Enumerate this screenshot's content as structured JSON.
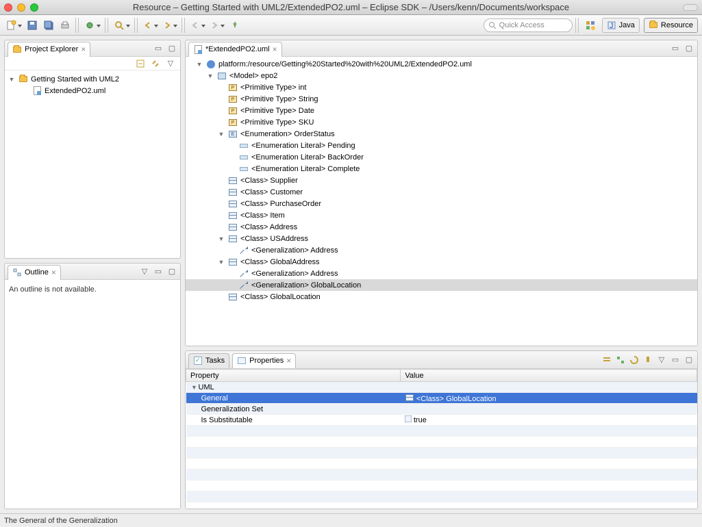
{
  "window": {
    "title": "Resource – Getting Started with UML2/ExtendedPO2.uml – Eclipse SDK – /Users/kenn/Documents/workspace"
  },
  "toolbar": {
    "quick_access_placeholder": "Quick Access",
    "perspectives": {
      "java": "Java",
      "resource": "Resource"
    }
  },
  "project_explorer": {
    "title": "Project Explorer",
    "project": "Getting Started with UML2",
    "file": "ExtendedPO2.uml"
  },
  "outline": {
    "title": "Outline",
    "empty_text": "An outline is not available."
  },
  "editor": {
    "tab_title": "*ExtendedPO2.uml",
    "root": "platform:/resource/Getting%20Started%20with%20UML2/ExtendedPO2.uml",
    "model": "<Model> epo2",
    "prim_int": "<Primitive Type> int",
    "prim_string": "<Primitive Type> String",
    "prim_date": "<Primitive Type> Date",
    "prim_sku": "<Primitive Type> SKU",
    "enum": "<Enumeration> OrderStatus",
    "enum_pending": "<Enumeration Literal> Pending",
    "enum_backorder": "<Enumeration Literal> BackOrder",
    "enum_complete": "<Enumeration Literal> Complete",
    "cls_supplier": "<Class> Supplier",
    "cls_customer": "<Class> Customer",
    "cls_po": "<Class> PurchaseOrder",
    "cls_item": "<Class> Item",
    "cls_address": "<Class> Address",
    "cls_usaddress": "<Class> USAddress",
    "gen_address1": "<Generalization> Address",
    "cls_globaladdress": "<Class> GlobalAddress",
    "gen_address2": "<Generalization> Address",
    "gen_globallocation": "<Generalization> GlobalLocation",
    "cls_globallocation": "<Class> GlobalLocation"
  },
  "bottom": {
    "tasks_tab": "Tasks",
    "properties_tab": "Properties",
    "columns": {
      "property": "Property",
      "value": "Value"
    },
    "group": "UML",
    "rows": {
      "general": {
        "label": "General",
        "value": "<Class> GlobalLocation"
      },
      "genset": {
        "label": "Generalization Set",
        "value": ""
      },
      "issub": {
        "label": "Is Substitutable",
        "value": "true"
      }
    }
  },
  "status": {
    "text": "The General of the Generalization"
  }
}
